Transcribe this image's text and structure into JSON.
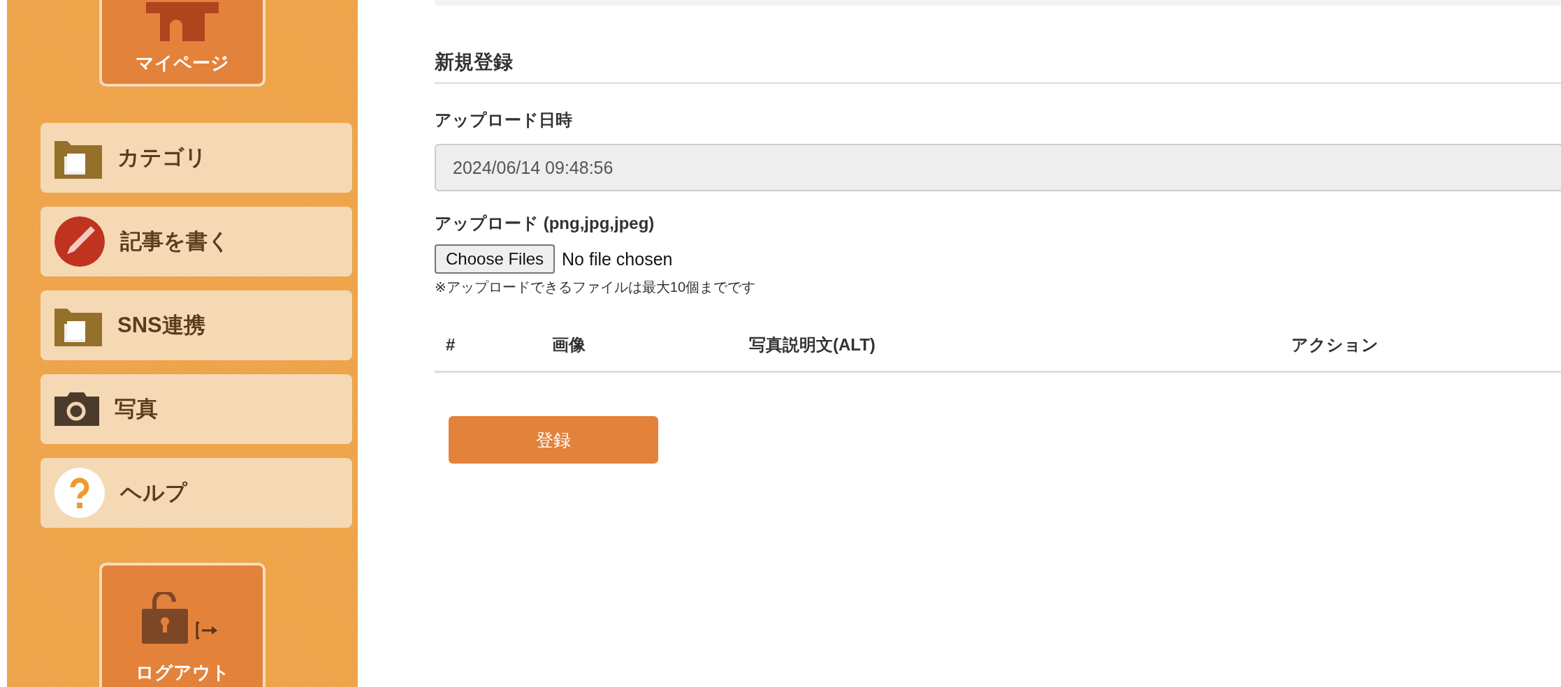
{
  "sidebar": {
    "top_button": {
      "label": "マイページ"
    },
    "items": [
      {
        "label": "カテゴリ",
        "kind": "folder"
      },
      {
        "label": "記事を書く",
        "kind": "pencil"
      },
      {
        "label": "SNS連携",
        "kind": "folder"
      },
      {
        "label": "写真",
        "kind": "camera"
      },
      {
        "label": "ヘルプ",
        "kind": "help"
      }
    ],
    "logout_button": {
      "label": "ログアウト"
    }
  },
  "form": {
    "title": "新規登録",
    "datetime": {
      "label": "アップロード日時",
      "value": "2024/06/14 09:48:56"
    },
    "upload": {
      "label": "アップロード (png,jpg,jpeg)",
      "button": "Choose Files",
      "status": "No file chosen",
      "note": "※アップロードできるファイルは最大10個までです"
    },
    "table": {
      "columns": [
        "#",
        "画像",
        "写真説明文(ALT)",
        "アクション"
      ]
    },
    "submit": "登録"
  }
}
